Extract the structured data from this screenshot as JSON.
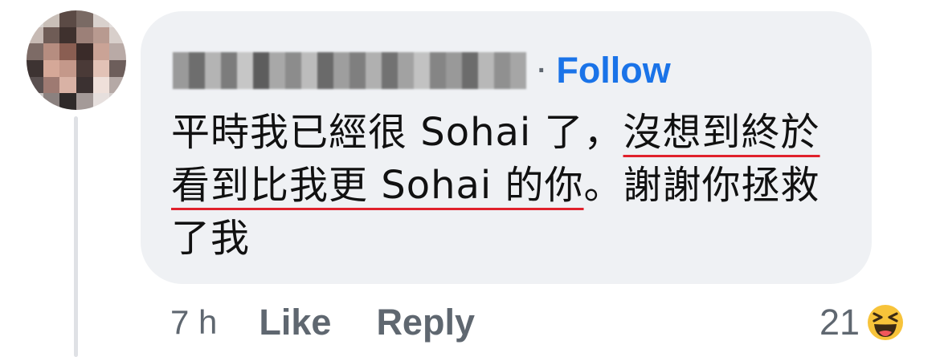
{
  "comment": {
    "follow_label": "Follow",
    "separator": "·",
    "text_parts": [
      "平時我已經很 Sohai 了，",
      "沒想到終於看到比我更 Sohai 的你",
      "。謝謝你拯救了我"
    ]
  },
  "actions": {
    "time": "7 h",
    "like_label": "Like",
    "reply_label": "Reply"
  },
  "reactions": {
    "count": "21",
    "icon": "haha-emoji-icon"
  },
  "colors": {
    "follow": "#1a73e8",
    "bubble": "#eff1f4",
    "meta_text": "#5f6770",
    "underline": "#e0212c"
  }
}
